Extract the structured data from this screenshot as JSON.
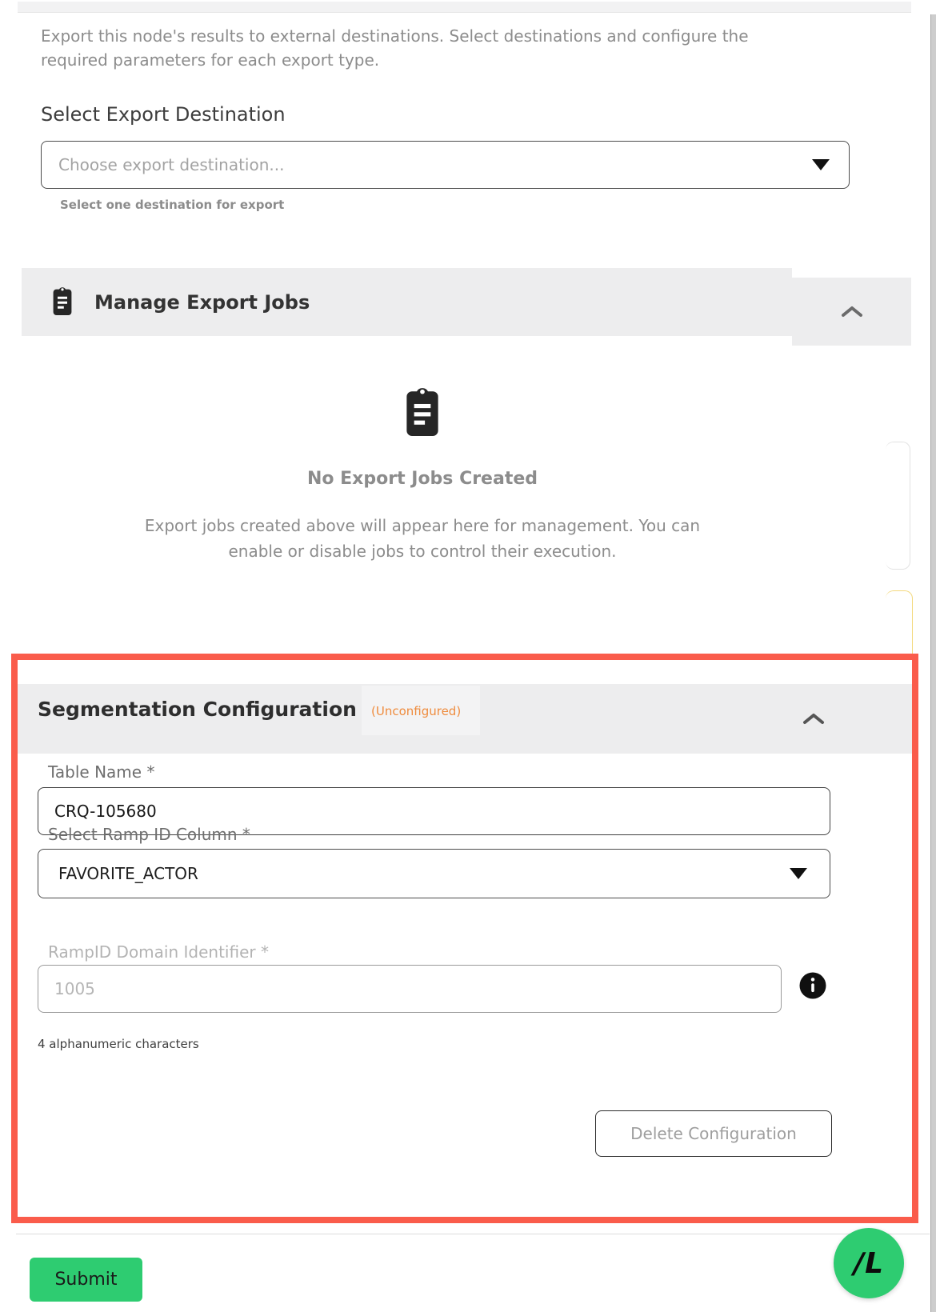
{
  "colors": {
    "highlight_red": "#fa5c4b",
    "status_orange": "#ef8c3e",
    "action_green": "#2ecc71",
    "section_header_gray": "#ededee",
    "edge_card_yellow": "#f3d97e"
  },
  "export_panel": {
    "description": "Export this node's results to external destinations. Select destinations and configure the required parameters for each export type.",
    "destination": {
      "label": "Select Export Destination",
      "placeholder": "Choose export destination...",
      "helper": "Select one destination for export"
    }
  },
  "manage_jobs": {
    "title": "Manage Export Jobs",
    "empty": {
      "title": "No Export Jobs Created",
      "description": "Export jobs created above will appear here for management. You can enable or disable jobs to control their execution."
    }
  },
  "segmentation": {
    "title": "Segmentation Configuration",
    "status_badge": "(Unconfigured)",
    "fields": {
      "table_name": {
        "label": "Table Name *",
        "value": "CRQ-105680"
      },
      "ramp_id_column": {
        "label": "Select Ramp ID Column *",
        "value": "FAVORITE_ACTOR"
      },
      "domain_identifier": {
        "label": "RampID Domain Identifier *",
        "placeholder": "1005",
        "helper": "4 alphanumeric characters"
      }
    },
    "delete_button_label": "Delete Configuration"
  },
  "footer": {
    "submit_label": "Submit"
  },
  "fab": {
    "label": "/L"
  }
}
